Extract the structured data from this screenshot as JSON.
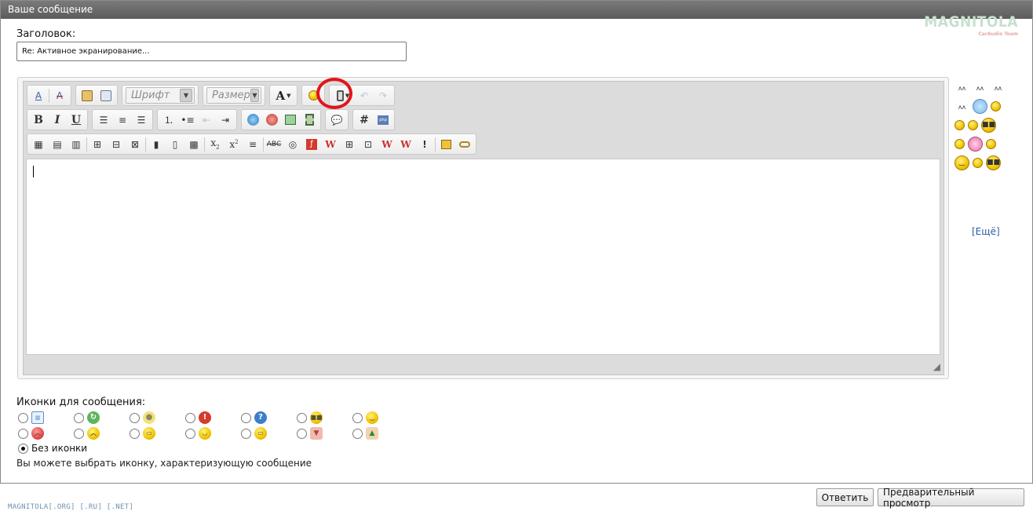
{
  "panel": {
    "title": "Ваше сообщение"
  },
  "logo": {
    "text": "MAGNITOLA",
    "subtitle": "CarAudio Team"
  },
  "form": {
    "title_label": "Заголовок:",
    "title_value": "Re: Активное экранирование..."
  },
  "toolbar": {
    "font_label": "Шрифт",
    "size_label": "Размер",
    "row1": [
      "remove-format",
      "spell-check",
      "paste-word",
      "paste-text",
      "font",
      "size",
      "text-color",
      "smiley",
      "attach-menu",
      "undo",
      "redo"
    ],
    "row2": [
      "bold",
      "italic",
      "underline",
      "align-left",
      "align-center",
      "align-right",
      "ordered-list",
      "unordered-list",
      "outdent",
      "indent",
      "link",
      "unlink",
      "image",
      "video",
      "quote",
      "code",
      "php"
    ],
    "row3": [
      "table",
      "table-props",
      "table-delete",
      "row-before",
      "row-after",
      "row-delete",
      "col-before",
      "col-after",
      "col-delete",
      "subscript",
      "superscript",
      "hr",
      "strikethrough",
      "spoiler",
      "flash",
      "wiki",
      "expand",
      "toc",
      "wiki-link",
      "wiki-edit",
      "excl",
      "copy",
      "link2"
    ]
  },
  "highlight_color": "#e0161a",
  "smilies": {
    "rows": [
      [
        "txt",
        "txt",
        "txt"
      ],
      [
        "txt",
        "star",
        "face"
      ],
      [
        "face",
        "face",
        "cool"
      ],
      [
        "face",
        "pink",
        "face"
      ],
      [
        "face",
        "face",
        "cool"
      ]
    ],
    "more_label": "[Ещё]"
  },
  "icons": {
    "label": "Иконки для сообщения:",
    "row1": [
      "doc",
      "arrow",
      "bulb",
      "excl",
      "quest",
      "cool",
      "face"
    ],
    "row2": [
      "angry",
      "face",
      "face",
      "face",
      "face",
      "thumbdown",
      "thumbup"
    ],
    "no_icon_label": "Без иконки",
    "hint": "Вы можете выбрать иконку, характеризующую сообщение"
  },
  "footer": {
    "link": "MAGNITOLA[.ORG] [.RU] [.NET]"
  },
  "buttons": {
    "reply": "Ответить",
    "preview": "Предварительный просмотр"
  }
}
